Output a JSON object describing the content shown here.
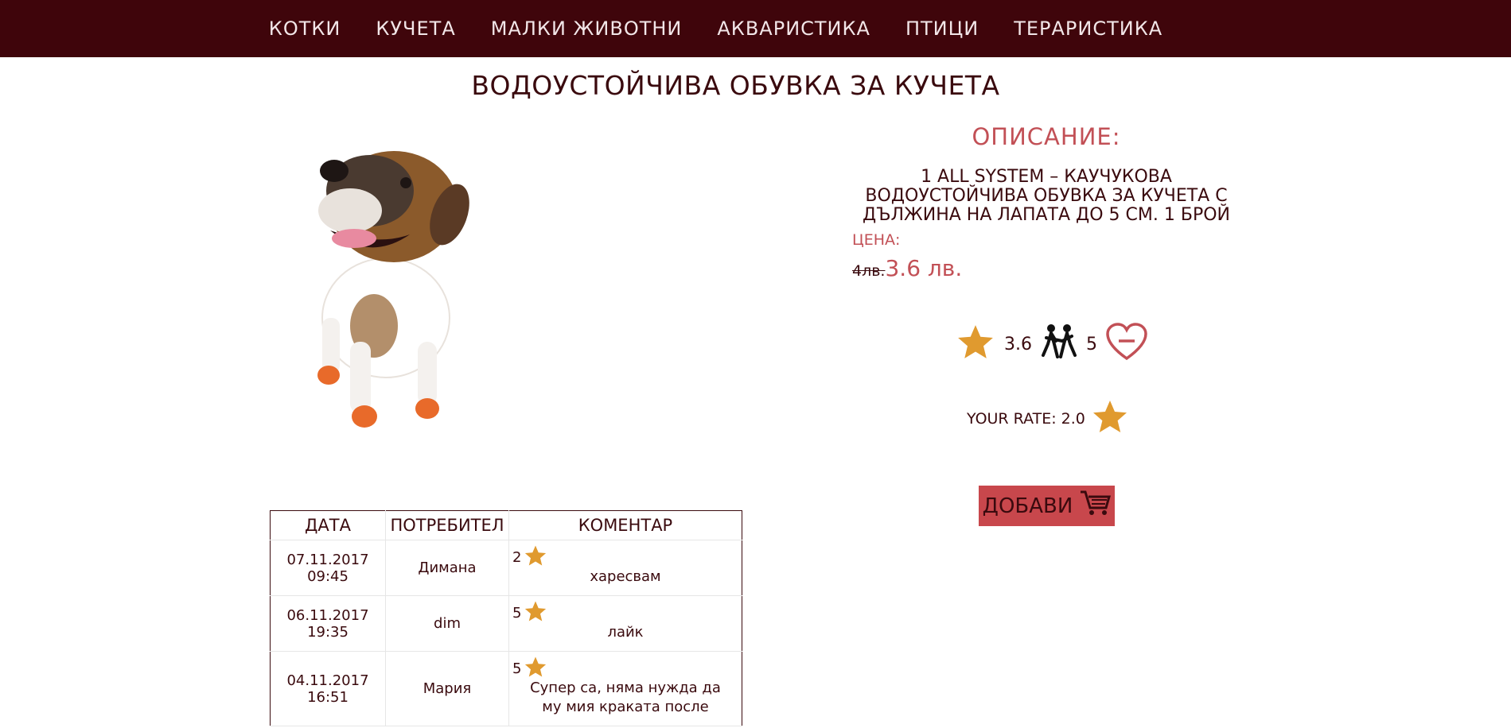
{
  "nav": {
    "items": [
      "КОТКИ",
      "КУЧЕТА",
      "МАЛКИ ЖИВОТНИ",
      "АКВАРИСТИКА",
      "ПТИЦИ",
      "ТЕРАРИСТИКА"
    ]
  },
  "product": {
    "title": "ВОДОУСТОЙЧИВА ОБУВКА ЗА КУЧЕТА",
    "description_heading": "ОПИСАНИЕ:",
    "description": "1 ALL SYSTEM – КАУЧУКОВА ВОДОУСТОЙЧИВА ОБУВКА ЗА КУЧЕТА С ДЪЛЖИНА НА ЛАПАТА ДО 5 СМ. 1 БРОЙ",
    "price_label": "ЦЕНА:",
    "old_price": "4лв.",
    "new_price": "3.6 лв.",
    "rating": "3.6",
    "voters": "5",
    "your_rate_label": "YOUR RATE: 2.0",
    "add_button_label": "ДОБАВИ",
    "image_icon": "dog-photo"
  },
  "colors": {
    "navbar": "#3f050b",
    "accent": "#c25056",
    "star": "#e09a2f",
    "button": "#c8474c"
  },
  "comments": {
    "headers": [
      "ДАТА",
      "ПОТРЕБИТЕЛ",
      "КОМЕНТАР"
    ],
    "rows": [
      {
        "date": "07.11.2017 09:45",
        "user": "Димана",
        "rating": "2",
        "text": "харесвам"
      },
      {
        "date": "06.11.2017 19:35",
        "user": "dim",
        "rating": "5",
        "text": "лайк"
      },
      {
        "date": "04.11.2017 16:51",
        "user": "Мария",
        "rating": "5",
        "text": "Супер са, няма нужда да му мия краката после"
      }
    ]
  }
}
